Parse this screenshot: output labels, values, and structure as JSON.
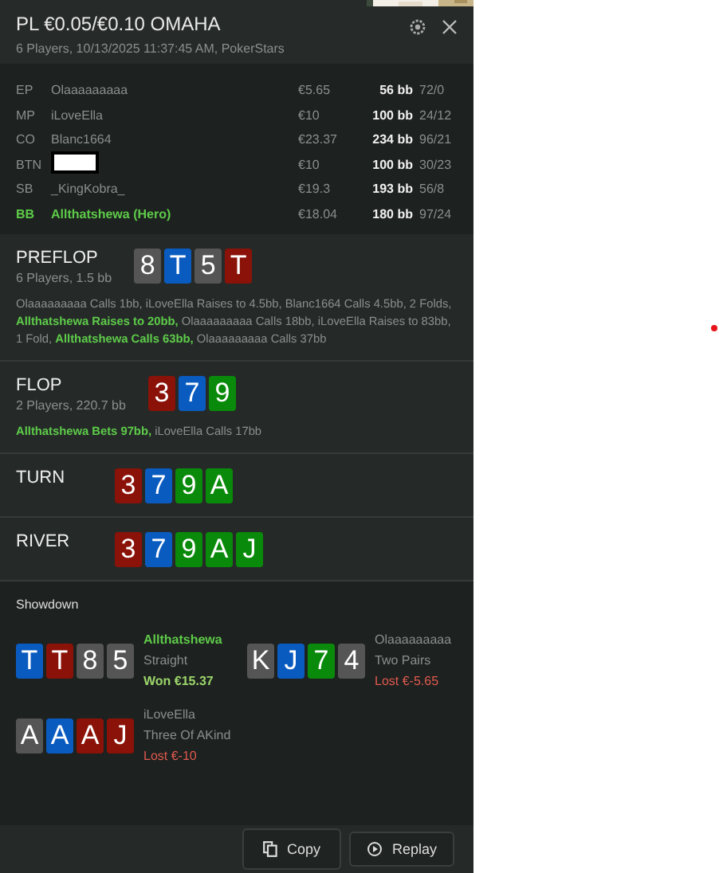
{
  "header": {
    "title": "PL €0.05/€0.10 OMAHA",
    "subtitle": "6 Players, 10/13/2025 11:37:45 AM, PokerStars"
  },
  "players": [
    {
      "position": "EP",
      "name": "Olaaaaaaaaa",
      "stack": "€5.65",
      "bb": "56 bb",
      "stats": "72/0",
      "hero": false,
      "redacted": false
    },
    {
      "position": "MP",
      "name": "iLoveElla",
      "stack": "€10",
      "bb": "100 bb",
      "stats": "24/12",
      "hero": false,
      "redacted": false
    },
    {
      "position": "CO",
      "name": "Blanc1664",
      "stack": "€23.37",
      "bb": "234 bb",
      "stats": "96/21",
      "hero": false,
      "redacted": false
    },
    {
      "position": "BTN",
      "stack": "€10",
      "bb": "100 bb",
      "stats": "30/23",
      "hero": false,
      "redacted": true
    },
    {
      "position": "SB",
      "name": "_KingKobra_",
      "stack": "€19.3",
      "bb": "193 bb",
      "stats": "56/8",
      "hero": false,
      "redacted": false
    },
    {
      "position": "BB",
      "name": "Allthatshewa (Hero)",
      "stack": "€18.04",
      "bb": "180 bb",
      "stats": "97/24",
      "hero": true,
      "redacted": false
    }
  ],
  "streets": [
    {
      "name": "PREFLOP",
      "info": "6 Players, 1.5 bb",
      "cards": [
        {
          "rank": "8",
          "color": "#555555"
        },
        {
          "rank": "T",
          "color": "#0a5bc0"
        },
        {
          "rank": "5",
          "color": "#555555"
        },
        {
          "rank": "T",
          "color": "#8a1208"
        }
      ],
      "actions": "Olaaaaaaaaa Calls 1bb, iLoveElla Raises to 4.5bb, Blanc1664 Calls 4.5bb, 2 Folds, **Allthatshewa Raises to 20bb,** Olaaaaaaaaa Calls 18bb, iLoveElla Raises to 83bb, 1 Fold, **Allthatshewa Calls 63bb,** Olaaaaaaaaa Calls 37bb"
    },
    {
      "name": "FLOP",
      "info": "2 Players, 220.7 bb",
      "cards": [
        {
          "rank": "3",
          "color": "#8a1208"
        },
        {
          "rank": "7",
          "color": "#0a5bc0"
        },
        {
          "rank": "9",
          "color": "#0a8a0a"
        }
      ],
      "actions": "**Allthatshewa Bets 97bb,** iLoveElla Calls 17bb"
    },
    {
      "name": "TURN",
      "cards": [
        {
          "rank": "3",
          "color": "#8a1208"
        },
        {
          "rank": "7",
          "color": "#0a5bc0"
        },
        {
          "rank": "9",
          "color": "#0a8a0a"
        },
        {
          "rank": "A",
          "color": "#0a8a0a"
        }
      ]
    },
    {
      "name": "RIVER",
      "cards": [
        {
          "rank": "3",
          "color": "#8a1208"
        },
        {
          "rank": "7",
          "color": "#0a5bc0"
        },
        {
          "rank": "9",
          "color": "#0a8a0a"
        },
        {
          "rank": "A",
          "color": "#0a8a0a"
        },
        {
          "rank": "J",
          "color": "#0a8a0a"
        }
      ]
    }
  ],
  "showdown": {
    "title": "Showdown",
    "hands": [
      {
        "player": "Allthatshewa",
        "hero": true,
        "hand": "Straight",
        "result": "Won €15.37",
        "won": true,
        "cards": [
          {
            "rank": "T",
            "color": "#0a5bc0"
          },
          {
            "rank": "T",
            "color": "#8a1208"
          },
          {
            "rank": "8",
            "color": "#555555"
          },
          {
            "rank": "5",
            "color": "#555555"
          }
        ]
      },
      {
        "player": "Olaaaaaaaaa",
        "hero": false,
        "hand": "Two Pairs",
        "result": "Lost €-5.65",
        "won": false,
        "cards": [
          {
            "rank": "K",
            "color": "#555555"
          },
          {
            "rank": "J",
            "color": "#0a5bc0"
          },
          {
            "rank": "7",
            "color": "#0a8a0a"
          },
          {
            "rank": "4",
            "color": "#555555"
          }
        ]
      },
      {
        "player": "iLoveElla",
        "hero": false,
        "hand": "Three Of AKind",
        "result": "Lost €-10",
        "won": false,
        "cards": [
          {
            "rank": "A",
            "color": "#555555"
          },
          {
            "rank": "A",
            "color": "#0a5bc0"
          },
          {
            "rank": "A",
            "color": "#8a1208"
          },
          {
            "rank": "J",
            "color": "#8a1208"
          }
        ]
      }
    ]
  },
  "buttons": [
    {
      "label": "Copy",
      "kind": "copy"
    },
    {
      "label": "Replay",
      "kind": "replay"
    }
  ]
}
